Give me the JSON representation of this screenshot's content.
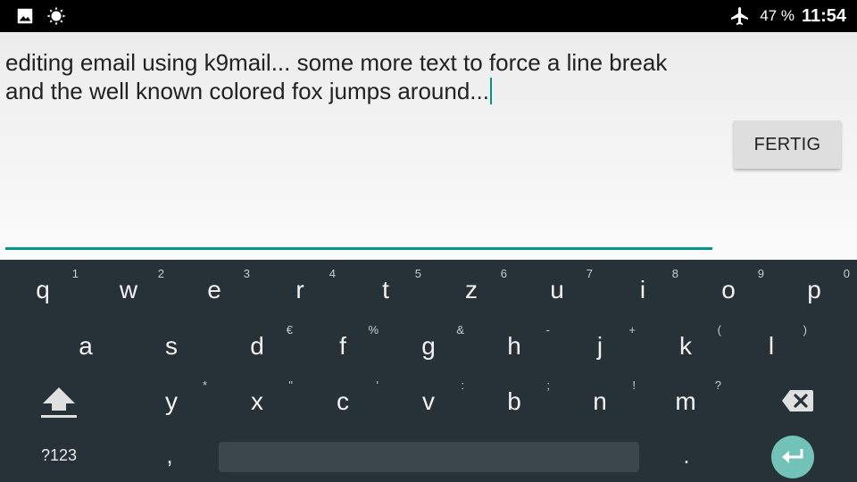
{
  "status_bar": {
    "battery": "47 %",
    "clock": "11:54",
    "icons": [
      "image-notification-icon",
      "brightness-icon",
      "airplane-mode-icon"
    ]
  },
  "editor": {
    "line1": "editing email using k9mail... some more text to force a line break",
    "line2": "and the well known colored fox jumps around...",
    "done_label": "FERTIG",
    "accent": "#009688"
  },
  "keyboard": {
    "row1": [
      {
        "key": "q",
        "hint": "1"
      },
      {
        "key": "w",
        "hint": "2"
      },
      {
        "key": "e",
        "hint": "3"
      },
      {
        "key": "r",
        "hint": "4"
      },
      {
        "key": "t",
        "hint": "5"
      },
      {
        "key": "z",
        "hint": "6"
      },
      {
        "key": "u",
        "hint": "7"
      },
      {
        "key": "i",
        "hint": "8"
      },
      {
        "key": "o",
        "hint": "9"
      },
      {
        "key": "p",
        "hint": "0"
      }
    ],
    "row2": [
      {
        "key": "a",
        "hint": ""
      },
      {
        "key": "s",
        "hint": ""
      },
      {
        "key": "d",
        "hint": "€"
      },
      {
        "key": "f",
        "hint": "%"
      },
      {
        "key": "g",
        "hint": "&"
      },
      {
        "key": "h",
        "hint": "-"
      },
      {
        "key": "j",
        "hint": "+"
      },
      {
        "key": "k",
        "hint": "("
      },
      {
        "key": "l",
        "hint": ")"
      }
    ],
    "row3": [
      {
        "key": "y",
        "hint": "*"
      },
      {
        "key": "x",
        "hint": "\""
      },
      {
        "key": "c",
        "hint": "'"
      },
      {
        "key": "v",
        "hint": ":"
      },
      {
        "key": "b",
        "hint": ";"
      },
      {
        "key": "n",
        "hint": "!"
      },
      {
        "key": "m",
        "hint": "?"
      }
    ],
    "symbols_label": "?123",
    "comma": ",",
    "period": ".",
    "background": "#263238",
    "enter_color": "#72c2b8"
  }
}
